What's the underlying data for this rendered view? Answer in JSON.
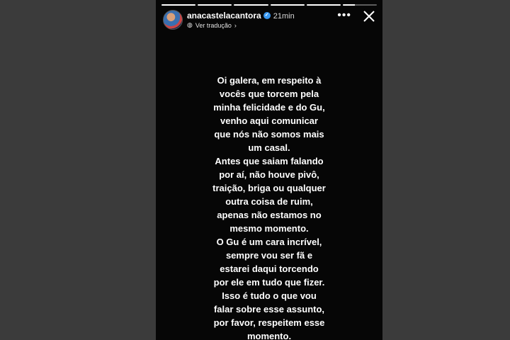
{
  "header": {
    "username": "anacastelacantora",
    "time": "21min",
    "translate_label": "Ver tradução",
    "progress": [
      1,
      1,
      1,
      1,
      1,
      0.35
    ]
  },
  "icons": {
    "verified": "verified-badge-icon",
    "translate": "globe-icon",
    "more": "more-options-icon",
    "close": "close-icon"
  },
  "story": {
    "message": "Oi galera, em respeito à\nvocês que torcem pela\nminha felicidade e do Gu,\nvenho aqui comunicar\nque nós não somos mais\num casal.\nAntes que saiam falando\npor aí, não houve pivô,\ntraição, briga ou qualquer\noutra coisa de ruim,\napenas não estamos no\nmesmo momento.\nO Gu é um cara incrível,\nsempre vou ser fã e\nestarei daqui torcendo\npor ele em tudo que fizer.\nIsso é tudo o que vou\nfalar sobre esse assunto,\npor favor, respeitem esse\nmomento."
  },
  "colors": {
    "story_background": "#060606",
    "page_background": "#3b3b3b",
    "text": "#ffffff"
  }
}
